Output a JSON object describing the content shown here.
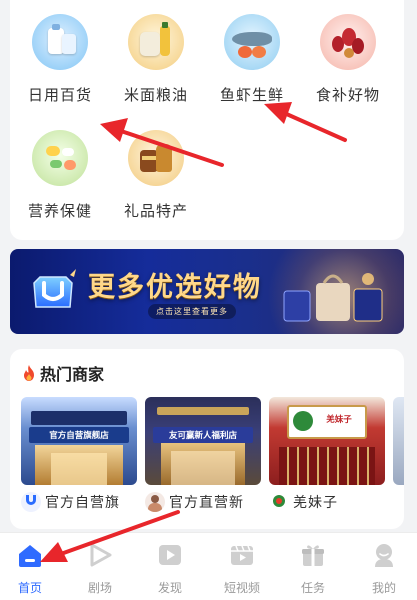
{
  "categories": [
    {
      "label": "日用百货",
      "icon": "daily-goods-icon"
    },
    {
      "label": "米面粮油",
      "icon": "grain-oil-icon"
    },
    {
      "label": "鱼虾生鲜",
      "icon": "seafood-icon"
    },
    {
      "label": "食补好物",
      "icon": "tonic-food-icon"
    },
    {
      "label": "营养保健",
      "icon": "nutrition-icon"
    },
    {
      "label": "礼品特产",
      "icon": "gift-specialty-icon"
    }
  ],
  "banner": {
    "title": "更多优选好物",
    "subtitle": "点击这里查看更多"
  },
  "hot": {
    "title": "热门商家",
    "shops": [
      {
        "sign": "官方自营旗舰店",
        "name": "官方自营旗"
      },
      {
        "sign": "友可赢新人福利店",
        "name": "官方直营新"
      },
      {
        "sign": "羌妹子",
        "name": "羌妹子"
      }
    ]
  },
  "tabs": [
    {
      "label": "首页",
      "icon": "home-icon",
      "active": true
    },
    {
      "label": "剧场",
      "icon": "theater-icon",
      "active": false
    },
    {
      "label": "发现",
      "icon": "discover-icon",
      "active": false
    },
    {
      "label": "短视频",
      "icon": "short-video-icon",
      "active": false
    },
    {
      "label": "任务",
      "icon": "task-gift-icon",
      "active": false
    },
    {
      "label": "我的",
      "icon": "profile-icon",
      "active": false
    }
  ],
  "colors": {
    "accent": "#2f6bff",
    "annotation": "#e8262b",
    "banner_bg": "#152c9a",
    "banner_text": "#ffd88a"
  }
}
